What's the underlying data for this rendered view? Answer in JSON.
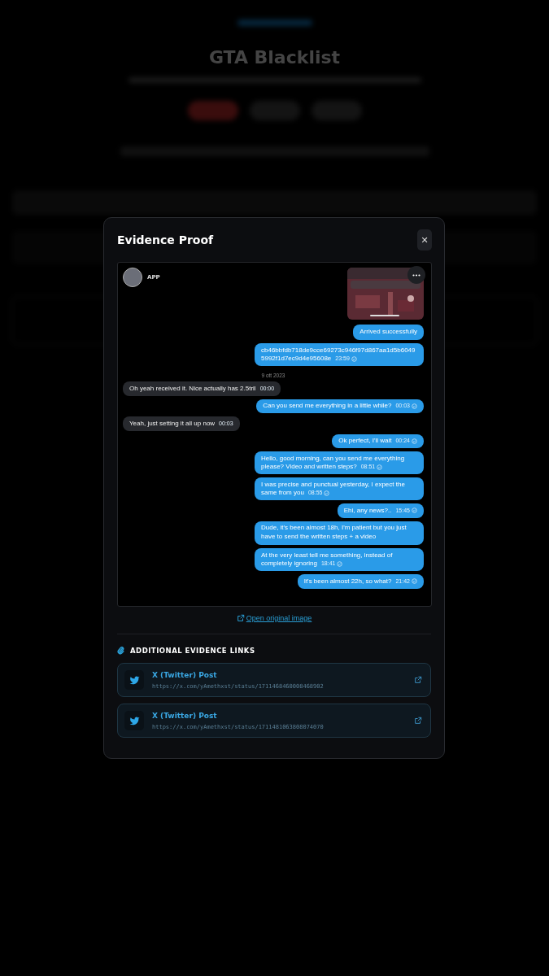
{
  "background": {
    "title": "GTA Blacklist"
  },
  "modal": {
    "title": "Evidence Proof",
    "close": "✕"
  },
  "chat": {
    "contact": "APP",
    "messages": [
      {
        "kind": "outgoing",
        "text": "Arrived successfully"
      },
      {
        "kind": "outgoing",
        "text": "cb46bbfdb718de9cce69273c946f97d867aa1d5b60495992f1d7ec9d4e95608e",
        "time": "23:59"
      },
      {
        "kind": "date",
        "text": "9 ott 2023"
      },
      {
        "kind": "incoming",
        "text": "Oh yeah received it. Nice actually has 2.5tril",
        "time": "00:00"
      },
      {
        "kind": "outgoing",
        "text": "Can you send me everything in a little while?",
        "time": "00:03"
      },
      {
        "kind": "incoming",
        "text": "Yeah, just setting it all up now",
        "time": "00:03"
      },
      {
        "kind": "outgoing",
        "text": "Ok perfect, I'll wait",
        "time": "00:24"
      },
      {
        "kind": "outgoing",
        "text": "Hello, good morning, can you send me everything please? Video and written steps?",
        "time": "08:51"
      },
      {
        "kind": "outgoing",
        "text": "I was precise and punctual yesterday, I expect the same from you",
        "time": "08:55"
      },
      {
        "kind": "outgoing",
        "text": "Ehi, any news?..",
        "time": "15:45"
      },
      {
        "kind": "outgoing",
        "text": "Dude, it's been almost 18h, I'm patient but you just have to send the written steps + a video"
      },
      {
        "kind": "outgoing",
        "text": "At the very least tell me something, instead of completely ignoring",
        "time": "18:41"
      },
      {
        "kind": "outgoing",
        "text": "It's been almost 22h, so what?",
        "time": "21:42"
      }
    ]
  },
  "open_link": "Open original image",
  "links_heading": "ADDITIONAL EVIDENCE LINKS",
  "links": [
    {
      "title": "X (Twitter) Post",
      "url": "https://x.com/yAmethxst/status/1711468460008468902"
    },
    {
      "title": "X (Twitter) Post",
      "url": "https://x.com/yAmethxst/status/1711481063808074070"
    }
  ]
}
